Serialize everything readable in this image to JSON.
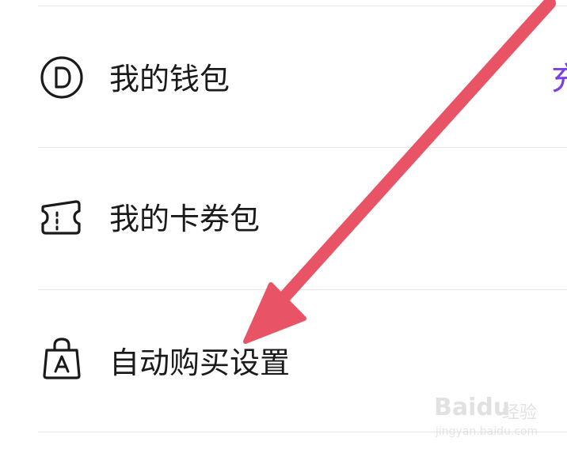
{
  "menu": {
    "items": [
      {
        "label": "我的钱包",
        "icon": "wallet-d-icon"
      },
      {
        "label": "我的卡券包",
        "icon": "ticket-icon"
      },
      {
        "label": "自动购买设置",
        "icon": "shopping-bag-a-icon"
      }
    ],
    "wallet_action_partial": "充"
  },
  "annotation": {
    "arrow_color": "#e85465"
  },
  "watermark": {
    "logo": "Bai",
    "logo_suffix": "du",
    "brand": "经验",
    "url": "jingyan.baidu.com"
  },
  "colors": {
    "accent": "#7b3fe4",
    "divider": "#e6e6e6",
    "text": "#1a1a1a"
  }
}
